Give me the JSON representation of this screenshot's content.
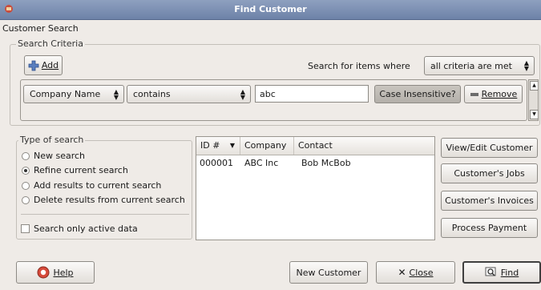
{
  "window": {
    "title": "Find Customer"
  },
  "header": {
    "label": "Customer Search"
  },
  "criteria": {
    "legend": "Search Criteria",
    "add_label": "Add",
    "search_items_label": "Search for items where",
    "match_mode": "all criteria are met",
    "row": {
      "field": "Company Name",
      "operator": "contains",
      "value": "abc",
      "case_label": "Case Insensitive?",
      "remove_label": "Remove"
    }
  },
  "type_of_search": {
    "legend": "Type of search",
    "options": [
      {
        "label": "New search",
        "selected": false
      },
      {
        "label": "Refine current search",
        "selected": true
      },
      {
        "label": "Add results to current search",
        "selected": false
      },
      {
        "label": "Delete results from current search",
        "selected": false
      }
    ],
    "active_only_label": "Search only active data",
    "active_only_checked": false
  },
  "results": {
    "columns": [
      "ID #",
      "Company",
      "Contact"
    ],
    "rows": [
      {
        "id": "000001",
        "company": "ABC Inc",
        "contact": "Bob McBob"
      }
    ]
  },
  "actions": {
    "view_edit": "View/Edit Customer",
    "jobs": "Customer's Jobs",
    "invoices": "Customer's Invoices",
    "payment": "Process Payment"
  },
  "footer": {
    "help": "Help",
    "new_customer": "New Customer",
    "close": "Close",
    "find": "Find"
  }
}
